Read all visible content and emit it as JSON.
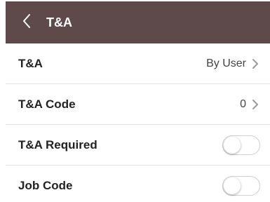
{
  "header": {
    "title": "T&A",
    "background_color": "#5e4a4a",
    "back_icon": "chevron-left-icon"
  },
  "rows": [
    {
      "label": "T&A",
      "value": "By User",
      "control": "chevron"
    },
    {
      "label": "T&A Code",
      "value": "0",
      "control": "chevron"
    },
    {
      "label": "T&A Required",
      "value": "",
      "control": "toggle",
      "checked": false
    },
    {
      "label": "Job Code",
      "value": "",
      "control": "toggle",
      "checked": false
    }
  ]
}
